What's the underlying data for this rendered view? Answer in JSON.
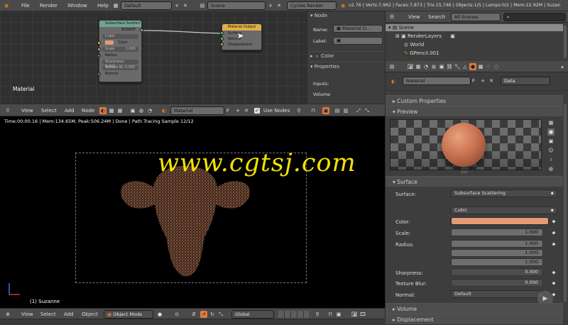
{
  "topbar": {
    "menus": [
      "File",
      "Render",
      "Window",
      "Help"
    ],
    "layout": "Default",
    "scene": "Scene",
    "engine": "Cycles Render",
    "stats": "v2.76 | Verts:7,962 | Faces:7,873 | Tris:15,746 | Objects:1/5 | Lamps:0/2 | Mem:22.92M | Suzan"
  },
  "node_editor": {
    "corner_label": "Material",
    "sss_node": {
      "title": "Subsurface Scatteri",
      "output": "BSSRDF",
      "falloff": "Cubic",
      "color_label": "Color",
      "scale_label": "Scale",
      "scale_value": "1.000",
      "radius_label": "Radius",
      "sharpness_label": "Sharpness: 0.000",
      "texblur_label": "Texture Bl: 0.000",
      "normal_label": "Normal"
    },
    "output_node": {
      "title": "Material Output",
      "inputs": [
        "Surface",
        "Volume",
        "Displacement"
      ]
    },
    "header": {
      "view": "View",
      "select": "Select",
      "add": "Add",
      "node": "Node",
      "material": "Material",
      "f_label": "F",
      "use_nodes": "Use Nodes"
    }
  },
  "node_props": {
    "title": "Node",
    "name_label": "Name:",
    "name_value": "Material O...",
    "label_label": "Label:",
    "color_section": "Color",
    "properties_section": "Properties",
    "inputs_label": "Inputs:",
    "volume_label": "Volume"
  },
  "outliner": {
    "view": "View",
    "search": "Search",
    "filter": "All Scenes",
    "items": [
      "Scene",
      "RenderLayers",
      "World",
      "GPencil.001"
    ]
  },
  "viewport": {
    "status": "Time:00:00.16 | Mem:134.65M, Peak:506.24M | Done | Path Tracing Sample 12/12",
    "watermark": "www.cgtsj.com",
    "object_label": "(1) Suzanne",
    "header": {
      "view": "View",
      "select": "Select",
      "add": "Add",
      "object": "Object",
      "mode": "Object Mode",
      "orientation": "Global"
    }
  },
  "properties": {
    "material_name": "Material",
    "f_label": "F",
    "data_label": "Data",
    "custom_props": "Custom Properties",
    "preview": "Preview",
    "surface_section": "Surface",
    "surface_label": "Surface:",
    "surface_value": "Subsurface Scattering",
    "falloff_value": "Cubic",
    "color_label": "Color:",
    "color_hex": "#e39b73",
    "scale_label": "Scale:",
    "scale_value": "1.000",
    "radius_label": "Radius:",
    "radius_values": [
      "1.000",
      "1.000",
      "1.000"
    ],
    "sharpness_label": "Sharpness:",
    "sharpness_value": "0.000",
    "texblur_label": "Texture Blur:",
    "texblur_value": "0.000",
    "normal_label": "Normal:",
    "normal_value": "Default",
    "volume_section": "Volume",
    "displacement_section": "Displacement"
  },
  "colors": {
    "sss_header": "#70a591",
    "output_header": "#e0b046",
    "link": "#c8c8c8",
    "watermark": "#f2e200",
    "sphere": "#c97252"
  }
}
